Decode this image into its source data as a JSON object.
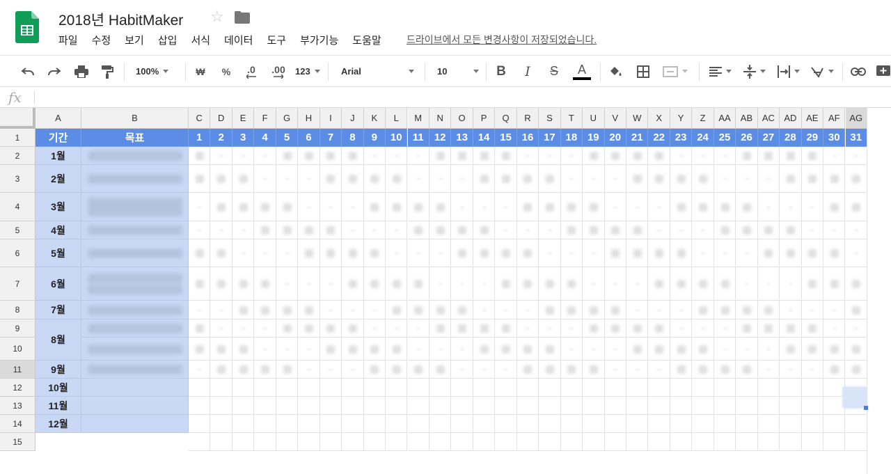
{
  "app": {
    "title": "2018년 HabitMaker",
    "save_status": "드라이브에서 모든 변경사항이 저장되었습니다.",
    "menu": [
      "파일",
      "수정",
      "보기",
      "삽입",
      "서식",
      "데이터",
      "도구",
      "부가기능",
      "도움말"
    ]
  },
  "toolbar": {
    "zoom": "100%",
    "currency": "₩",
    "percent": "%",
    "decimal_decrease": ".0",
    "decimal_increase": ".00",
    "more_formats": "123",
    "font": "Arial",
    "font_size": "10",
    "bold": "B",
    "italic": "I",
    "strikethrough": "S",
    "text_color": "A"
  },
  "formula_bar": {
    "fx_label": "fx",
    "value": ""
  },
  "sheet": {
    "column_letters": [
      "A",
      "B",
      "C",
      "D",
      "E",
      "F",
      "G",
      "H",
      "I",
      "J",
      "K",
      "L",
      "M",
      "N",
      "O",
      "P",
      "Q",
      "R",
      "S",
      "T",
      "U",
      "V",
      "W",
      "X",
      "Y",
      "Z",
      "AA",
      "AB",
      "AC",
      "AD",
      "AE",
      "AF",
      "AG"
    ],
    "row_numbers": [
      "1",
      "2",
      "3",
      "4",
      "5",
      "6",
      "7",
      "8",
      "9",
      "10",
      "11",
      "12",
      "13",
      "14",
      "15"
    ],
    "header": {
      "period": "기간",
      "goal": "목표",
      "days": [
        "1",
        "2",
        "3",
        "4",
        "5",
        "6",
        "7",
        "8",
        "9",
        "10",
        "11",
        "12",
        "13",
        "14",
        "15",
        "16",
        "17",
        "18",
        "19",
        "20",
        "21",
        "22",
        "23",
        "24",
        "25",
        "26",
        "27",
        "28",
        "29",
        "30",
        "31"
      ]
    },
    "months": [
      "1월",
      "2월",
      "3월",
      "4월",
      "5월",
      "6월",
      "7월",
      "8월",
      "9월",
      "10월",
      "11월",
      "12월"
    ]
  },
  "colors": {
    "header_fill": "#5b8de6",
    "month_fill": "#c9d9f5",
    "sheets_green": "#0f9d58"
  }
}
